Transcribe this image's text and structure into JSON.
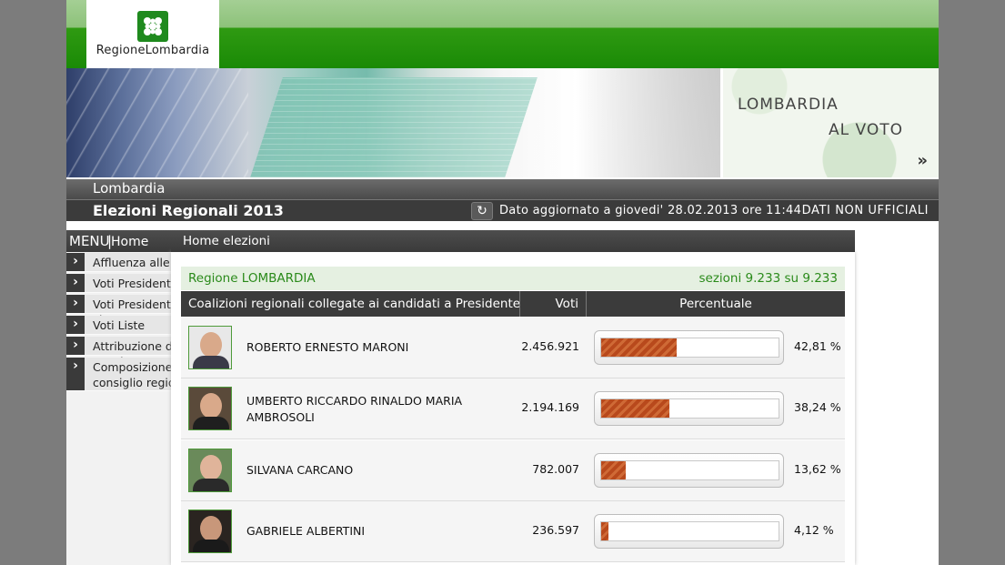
{
  "header": {
    "logo_text": "RegioneLombardia",
    "banner_title_line1": "LOMBARDIA",
    "banner_title_line2": "AL VOTO",
    "banner_arrow": "»"
  },
  "titles": {
    "region": "Lombardia",
    "election": "Elezioni Regionali 2013",
    "refresh_icon": "↻",
    "updated": "Dato aggiornato a giovedi' 28.02.2013 ore 11:44",
    "unofficial": "DATI NON UFFICIALI"
  },
  "menu": {
    "label": "MENU",
    "separator": "|",
    "home": "Home",
    "chevron": "›",
    "items": [
      {
        "label": "Affluenza alle urne"
      },
      {
        "label": "Voti Presidente"
      },
      {
        "label": "Voti Presidente e Liste"
      },
      {
        "label": "Voti Liste"
      },
      {
        "label": "Attribuzione dei seggi"
      },
      {
        "label": "Composizione consiglio regionale"
      }
    ]
  },
  "content": {
    "breadcrumb": "Home elezioni",
    "region_name": "Regione LOMBARDIA",
    "sections": "sezioni 9.233 su 9.233",
    "columns": {
      "coalitions": "Coalizioni regionali collegate ai candidati a Presidente",
      "votes": "Voti",
      "percent": "Percentuale"
    },
    "candidates": [
      {
        "name": "ROBERTO ERNESTO  MARONI",
        "votes": "2.456.921",
        "percent_label": "42,81 %",
        "percent": 42.81
      },
      {
        "name": "UMBERTO RICCARDO RINALDO MARIA AMBROSOLI",
        "votes": "2.194.169",
        "percent_label": "38,24 %",
        "percent": 38.24
      },
      {
        "name": "SILVANA  CARCANO",
        "votes": "782.007",
        "percent_label": "13,62 %",
        "percent": 13.62
      },
      {
        "name": "GABRIELE  ALBERTINI",
        "votes": "236.597",
        "percent_label": "4,12 %",
        "percent": 4.12
      }
    ]
  },
  "colors": {
    "header_green": "#1a8a06",
    "region_green": "#2a8a1a",
    "bar_fill": "#b8491c",
    "dark_bar": "#3b3b3b"
  }
}
